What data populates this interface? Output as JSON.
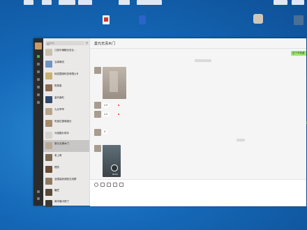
{
  "desktop": {
    "top_icons": [
      "",
      "",
      "",
      "",
      "",
      "",
      "",
      ""
    ],
    "icons": [
      {
        "label": "",
        "color": "#e8e8e8"
      },
      {
        "label": "",
        "color": "#2a63c9"
      },
      {
        "label": "",
        "color": "#cfc6b8"
      },
      {
        "label": "",
        "color": "#4a6f95"
      }
    ]
  },
  "sidebar": {
    "search_placeholder": "搜索",
    "plus": "+"
  },
  "chats": [
    {
      "name": "江西中储粮仓农业...",
      "preview": "",
      "time": "",
      "color": "#c9c0b0"
    },
    {
      "name": "当事情况",
      "preview": "",
      "time": "",
      "color": "#6f94c1"
    },
    {
      "name": "鈊宏围绕科技有限公司",
      "preview": "",
      "time": "",
      "color": "#c8b070"
    },
    {
      "name": "陈丽惠",
      "preview": "",
      "time": "",
      "color": "#8a6c54"
    },
    {
      "name": "金玲鑫虹",
      "preview": "",
      "time": "",
      "color": "#2f4a6e"
    },
    {
      "name": "九月爷爷",
      "preview": "",
      "time": "",
      "color": "#b7a48d"
    },
    {
      "name": "吃饭拉银城镇长",
      "preview": "",
      "time": "",
      "color": "#a58c6d"
    },
    {
      "name": "分组图片助手",
      "preview": "",
      "time": "",
      "color": "#d6d3cf"
    },
    {
      "name": "曼元无清木门",
      "preview": "",
      "time": "",
      "color": "#b9aa98"
    },
    {
      "name": "老上奇",
      "preview": "",
      "time": "",
      "color": "#7a6a54"
    },
    {
      "name": "理衣",
      "preview": "",
      "time": "",
      "color": "#6a4e3a"
    },
    {
      "name": "全国高效调查交流群",
      "preview": "",
      "time": "",
      "color": "#8e7a5e"
    },
    {
      "name": "糖豆",
      "preview": "",
      "time": "",
      "color": "#5a4a38"
    },
    {
      "name": "两不懂卡修了",
      "preview": "",
      "time": "",
      "color": "#3e3a36"
    }
  ],
  "chat": {
    "title": "曼元无清木门",
    "own_message": "这个不知道",
    "messages": [
      "4 0'",
      "4 0'",
      "4'"
    ],
    "video_duration": "00:00"
  },
  "colors": {
    "sent_bubble": "#9eea6a",
    "unread": "#f43530",
    "nav_bg": "#2b2b2b"
  }
}
